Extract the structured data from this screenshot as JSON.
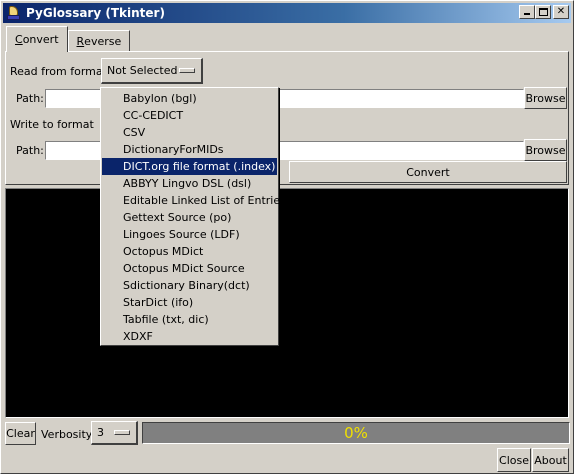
{
  "window": {
    "title": "PyGlossary (Tkinter)"
  },
  "tabs": [
    {
      "label_underline": "C",
      "label_rest": "onvert",
      "active": true
    },
    {
      "label_underline": "R",
      "label_rest": "everse",
      "active": false
    }
  ],
  "convert": {
    "read_label": "Read from format",
    "read_format_selected": "Not Selected",
    "input_path_label": "Path:",
    "input_path_value": "",
    "input_browse": "Browse",
    "write_label": "Write to format",
    "output_path_label": "Path:",
    "output_path_value": "",
    "output_browse": "Browse",
    "convert_button": "Convert"
  },
  "format_menu": {
    "items": [
      "Babylon (bgl)",
      "CC-CEDICT",
      "CSV",
      "DictionaryForMIDs",
      "DICT.org file format (.index)",
      "ABBYY Lingvo DSL (dsl)",
      "Editable Linked List of Entries",
      "Gettext Source (po)",
      "Lingoes Source (LDF)",
      "Octopus MDict",
      "Octopus MDict Source",
      "Sdictionary Binary(dct)",
      "StarDict (ifo)",
      "Tabfile (txt, dic)",
      "XDXF"
    ],
    "highlighted_index": 4
  },
  "bottom": {
    "clear_button": "Clear",
    "verbosity_label": "Verbosity",
    "verbosity_value": "3",
    "progress_text": "0%",
    "progress_fraction": 0,
    "close_button": "Close",
    "about_button": "About"
  },
  "colors": {
    "console_bg": "#000000",
    "progress_text": "#f0e000",
    "highlight": "#0a246a"
  }
}
